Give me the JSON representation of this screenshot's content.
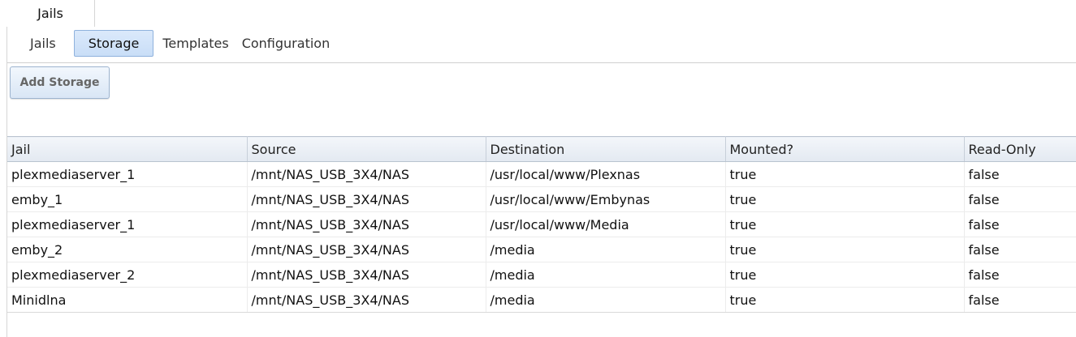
{
  "outer_tab": {
    "label": "Jails"
  },
  "sub_tabs": [
    "Jails",
    "Storage",
    "Templates",
    "Configuration"
  ],
  "active_sub_tab": "Storage",
  "toolbar": {
    "add_storage_label": "Add Storage"
  },
  "table": {
    "columns": [
      "Jail",
      "Source",
      "Destination",
      "Mounted?",
      "Read-Only"
    ],
    "rows": [
      [
        "plexmediaserver_1",
        "/mnt/NAS_USB_3X4/NAS",
        "/usr/local/www/Plexnas",
        "true",
        "false"
      ],
      [
        "emby_1",
        "/mnt/NAS_USB_3X4/NAS",
        "/usr/local/www/Embynas",
        "true",
        "false"
      ],
      [
        "plexmediaserver_1",
        "/mnt/NAS_USB_3X4/NAS",
        "/usr/local/www/Media",
        "true",
        "false"
      ],
      [
        "emby_2",
        "/mnt/NAS_USB_3X4/NAS",
        "/media",
        "true",
        "false"
      ],
      [
        "plexmediaserver_2",
        "/mnt/NAS_USB_3X4/NAS",
        "/media",
        "true",
        "false"
      ],
      [
        "Minidlna",
        "/mnt/NAS_USB_3X4/NAS",
        "/media",
        "true",
        "false"
      ]
    ]
  }
}
